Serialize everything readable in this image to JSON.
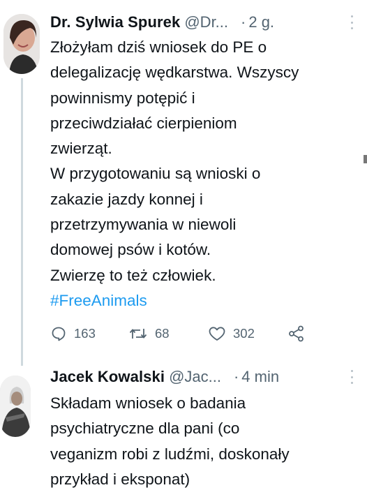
{
  "tweets": [
    {
      "author_name": "Dr. Sylwia Spurek",
      "handle": "@Dr...",
      "separator": "·",
      "time": "2 g.",
      "lines": [
        "Złożyłam dziś wniosek do PE o",
        "delegalizację wędkarstwa. Wszyscy",
        "powinnismy potępić i",
        "przeciwdziałać cierpieniom",
        "zwierząt.",
        "W przygotowaniu są wnioski o",
        "zakazie jazdy konnej i",
        "przetrzymywania w niewoli",
        "domowej psów i kotów.",
        "Zwierzę to też człowiek."
      ],
      "hashtag": "#FreeAnimals",
      "replies": "163",
      "retweets": "68",
      "likes": "302"
    },
    {
      "author_name": "Jacek Kowalski",
      "handle": "@Jac...",
      "separator": "·",
      "time": "4 min",
      "lines": [
        "Składam wniosek o badania",
        "psychiatryczne dla pani (co",
        "veganizm robi z ludźmi, doskonały",
        "przykład i eksponat)"
      ]
    }
  ],
  "colors": {
    "text": "#0f1419",
    "secondary": "#536471",
    "link": "#1d9bf0",
    "thread_line": "#cfd9de"
  },
  "icons": [
    "reply-icon",
    "retweet-icon",
    "like-icon",
    "share-icon",
    "more-options-icon"
  ]
}
